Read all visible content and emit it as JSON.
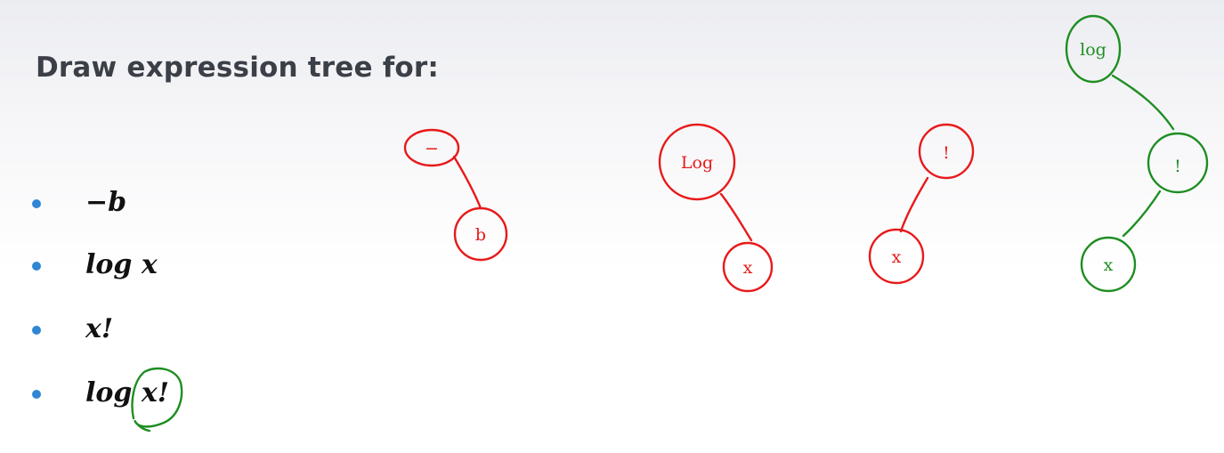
{
  "title": "Draw expression tree for:",
  "bullets": [
    {
      "text": "−b"
    },
    {
      "text": "log x"
    },
    {
      "text": "x!"
    },
    {
      "text": "log x!"
    }
  ],
  "annotation_colors": {
    "red": "#e81a1a",
    "green": "#1e8e22",
    "bullet": "#2e86d4"
  },
  "trees": [
    {
      "color": "red",
      "nodes": [
        "−",
        "b"
      ]
    },
    {
      "color": "red",
      "nodes": [
        "Log",
        "x"
      ]
    },
    {
      "color": "red",
      "nodes": [
        "!",
        "x"
      ]
    },
    {
      "color": "green",
      "nodes": [
        "log",
        "!",
        "x"
      ]
    }
  ]
}
